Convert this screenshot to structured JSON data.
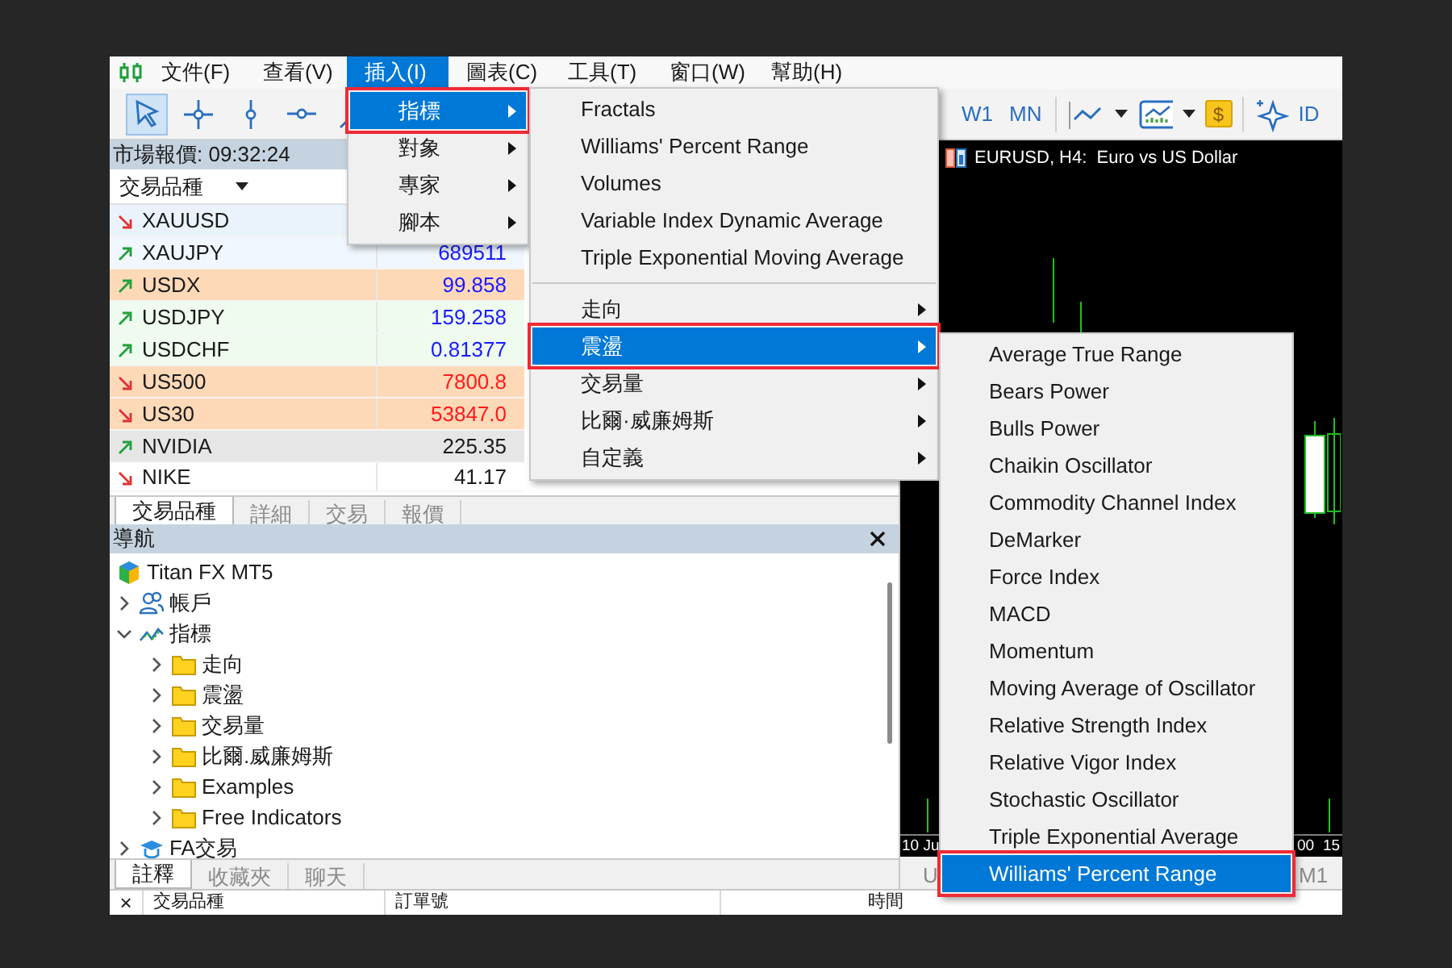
{
  "menu_bar": {
    "items": [
      {
        "label": "文件(F)",
        "selected": false
      },
      {
        "label": "查看(V)",
        "selected": false
      },
      {
        "label": "插入(I)",
        "selected": true
      },
      {
        "label": "圖表(C)",
        "selected": false
      },
      {
        "label": "工具(T)",
        "selected": false
      },
      {
        "label": "窗口(W)",
        "selected": false
      },
      {
        "label": "幫助(H)",
        "selected": false
      }
    ]
  },
  "toolbar": {
    "tools": [
      {
        "kind": "cursor",
        "selected": true
      },
      {
        "kind": "crosshair",
        "selected": false
      },
      {
        "kind": "vertical-line",
        "selected": false
      },
      {
        "kind": "horizontal-line",
        "selected": false
      },
      {
        "kind": "trend-line",
        "selected": false
      }
    ],
    "periods": [
      "W1",
      "MN"
    ],
    "dollar": "$",
    "cut_label": "ID"
  },
  "market_watch": {
    "title": "市場報價: 09:32:24",
    "column": "交易品種",
    "rows": [
      {
        "rising": false,
        "symbol": "XAUUSD",
        "color": "#eaf3fc"
      },
      {
        "rising": true,
        "symbol": "XAUJPY",
        "bid": "689511",
        "color": "#f0f7fe",
        "kind": "rising"
      },
      {
        "rising": true,
        "symbol": "USDX",
        "bid": "99.858",
        "color": "#fdd9b8",
        "kind": "rising"
      },
      {
        "rising": true,
        "symbol": "USDJPY",
        "bid": "159.258",
        "color": "#eefbee",
        "kind": "rising"
      },
      {
        "rising": true,
        "symbol": "USDCHF",
        "bid": "0.81377",
        "color": "#eefbee",
        "kind": "rising"
      },
      {
        "rising": false,
        "symbol": "US500",
        "bid": "7800.8",
        "color": "#fdd9b8",
        "kind": "falling"
      },
      {
        "rising": false,
        "symbol": "US30",
        "bid": "53847.0",
        "color": "#fdd9b8",
        "kind": "falling"
      },
      {
        "rising": true,
        "symbol": "NVIDIA",
        "bid": "225.35",
        "color": "#e6e6e6",
        "kind": "flat"
      },
      {
        "rising": false,
        "symbol": "NIKE",
        "bid": "41.17",
        "color": "#ffffff",
        "kind": "flat"
      }
    ],
    "tabs": [
      {
        "label": "交易品種",
        "selected": true
      },
      {
        "label": "詳細",
        "selected": false
      },
      {
        "label": "交易",
        "selected": false
      },
      {
        "label": "報價",
        "selected": false
      }
    ]
  },
  "navigator": {
    "title": "導航",
    "tree": [
      {
        "label": "Titan FX MT5",
        "kind": "broker",
        "children": [
          {
            "label": "帳戶",
            "kind": "accounts",
            "expanded": false
          },
          {
            "label": "指標",
            "kind": "indicators",
            "expanded": true,
            "children": [
              {
                "label": "走向",
                "kind": "folder",
                "expanded": false
              },
              {
                "label": "震盪",
                "kind": "folder",
                "expanded": false
              },
              {
                "label": "交易量",
                "kind": "folder",
                "expanded": false
              },
              {
                "label": "比爾.威廉姆斯",
                "kind": "folder",
                "expanded": false
              },
              {
                "label": "Examples",
                "kind": "folder",
                "expanded": false
              },
              {
                "label": "Free Indicators",
                "kind": "folder",
                "expanded": false
              }
            ]
          },
          {
            "label": "FA交易",
            "kind": "experts",
            "expanded": false
          }
        ]
      }
    ],
    "tabs": [
      {
        "label": "註釋",
        "selected": true
      },
      {
        "label": "收藏夾",
        "selected": false
      },
      {
        "label": "聊天",
        "selected": false
      }
    ]
  },
  "chart": {
    "title": "EURUSD, H4:  Euro vs US Dollar",
    "axis_labels": [
      "10 Ju",
      "00",
      "15"
    ],
    "tabs": [
      "U",
      "M1"
    ]
  },
  "toolbox": {
    "close": "×",
    "columns": [
      "交易品種",
      "訂單號",
      "時間"
    ]
  },
  "menus": [
    {
      "items": [
        {
          "kind": "item",
          "label": "指標",
          "submenu": true,
          "selected": true,
          "outlined": true
        },
        {
          "kind": "item",
          "label": "對象",
          "submenu": true,
          "selected": false,
          "outlined": false
        },
        {
          "kind": "item",
          "label": "專家",
          "submenu": true,
          "selected": false,
          "outlined": false
        },
        {
          "kind": "item",
          "label": "腳本",
          "submenu": true,
          "selected": false,
          "outlined": false
        }
      ]
    },
    {
      "items": [
        {
          "kind": "item",
          "label": "Fractals",
          "submenu": false,
          "selected": false,
          "outlined": false
        },
        {
          "kind": "item",
          "label": "Williams' Percent Range",
          "submenu": false,
          "selected": false,
          "outlined": false
        },
        {
          "kind": "item",
          "label": "Volumes",
          "submenu": false,
          "selected": false,
          "outlined": false
        },
        {
          "kind": "item",
          "label": "Variable Index Dynamic Average",
          "submenu": false,
          "selected": false,
          "outlined": false
        },
        {
          "kind": "item",
          "label": "Triple Exponential Moving Average",
          "submenu": false,
          "selected": false,
          "outlined": false
        },
        {
          "kind": "separator"
        },
        {
          "kind": "item",
          "label": "走向",
          "submenu": true,
          "selected": false,
          "outlined": false
        },
        {
          "kind": "item",
          "label": "震盪",
          "submenu": true,
          "selected": true,
          "outlined": true
        },
        {
          "kind": "item",
          "label": "交易量",
          "submenu": true,
          "selected": false,
          "outlined": false
        },
        {
          "kind": "item",
          "label": "比爾·威廉姆斯",
          "submenu": true,
          "selected": false,
          "outlined": false
        },
        {
          "kind": "item",
          "label": "自定義",
          "submenu": true,
          "selected": false,
          "outlined": false
        }
      ]
    },
    {
      "items": [
        {
          "kind": "item",
          "label": "Average True Range",
          "submenu": false,
          "selected": false,
          "outlined": false
        },
        {
          "kind": "item",
          "label": "Bears Power",
          "submenu": false,
          "selected": false,
          "outlined": false
        },
        {
          "kind": "item",
          "label": "Bulls Power",
          "submenu": false,
          "selected": false,
          "outlined": false
        },
        {
          "kind": "item",
          "label": "Chaikin Oscillator",
          "submenu": false,
          "selected": false,
          "outlined": false
        },
        {
          "kind": "item",
          "label": "Commodity Channel Index",
          "submenu": false,
          "selected": false,
          "outlined": false
        },
        {
          "kind": "item",
          "label": "DeMarker",
          "submenu": false,
          "selected": false,
          "outlined": false
        },
        {
          "kind": "item",
          "label": "Force Index",
          "submenu": false,
          "selected": false,
          "outlined": false
        },
        {
          "kind": "item",
          "label": "MACD",
          "submenu": false,
          "selected": false,
          "outlined": false
        },
        {
          "kind": "item",
          "label": "Momentum",
          "submenu": false,
          "selected": false,
          "outlined": false
        },
        {
          "kind": "item",
          "label": "Moving Average of Oscillator",
          "submenu": false,
          "selected": false,
          "outlined": false
        },
        {
          "kind": "item",
          "label": "Relative Strength Index",
          "submenu": false,
          "selected": false,
          "outlined": false
        },
        {
          "kind": "item",
          "label": "Relative Vigor Index",
          "submenu": false,
          "selected": false,
          "outlined": false
        },
        {
          "kind": "item",
          "label": "Stochastic Oscillator",
          "submenu": false,
          "selected": false,
          "outlined": false
        },
        {
          "kind": "item",
          "label": "Triple Exponential Average",
          "submenu": false,
          "selected": false,
          "outlined": false
        },
        {
          "kind": "item",
          "label": "Williams' Percent Range",
          "submenu": false,
          "selected": true,
          "outlined": true
        }
      ]
    }
  ]
}
